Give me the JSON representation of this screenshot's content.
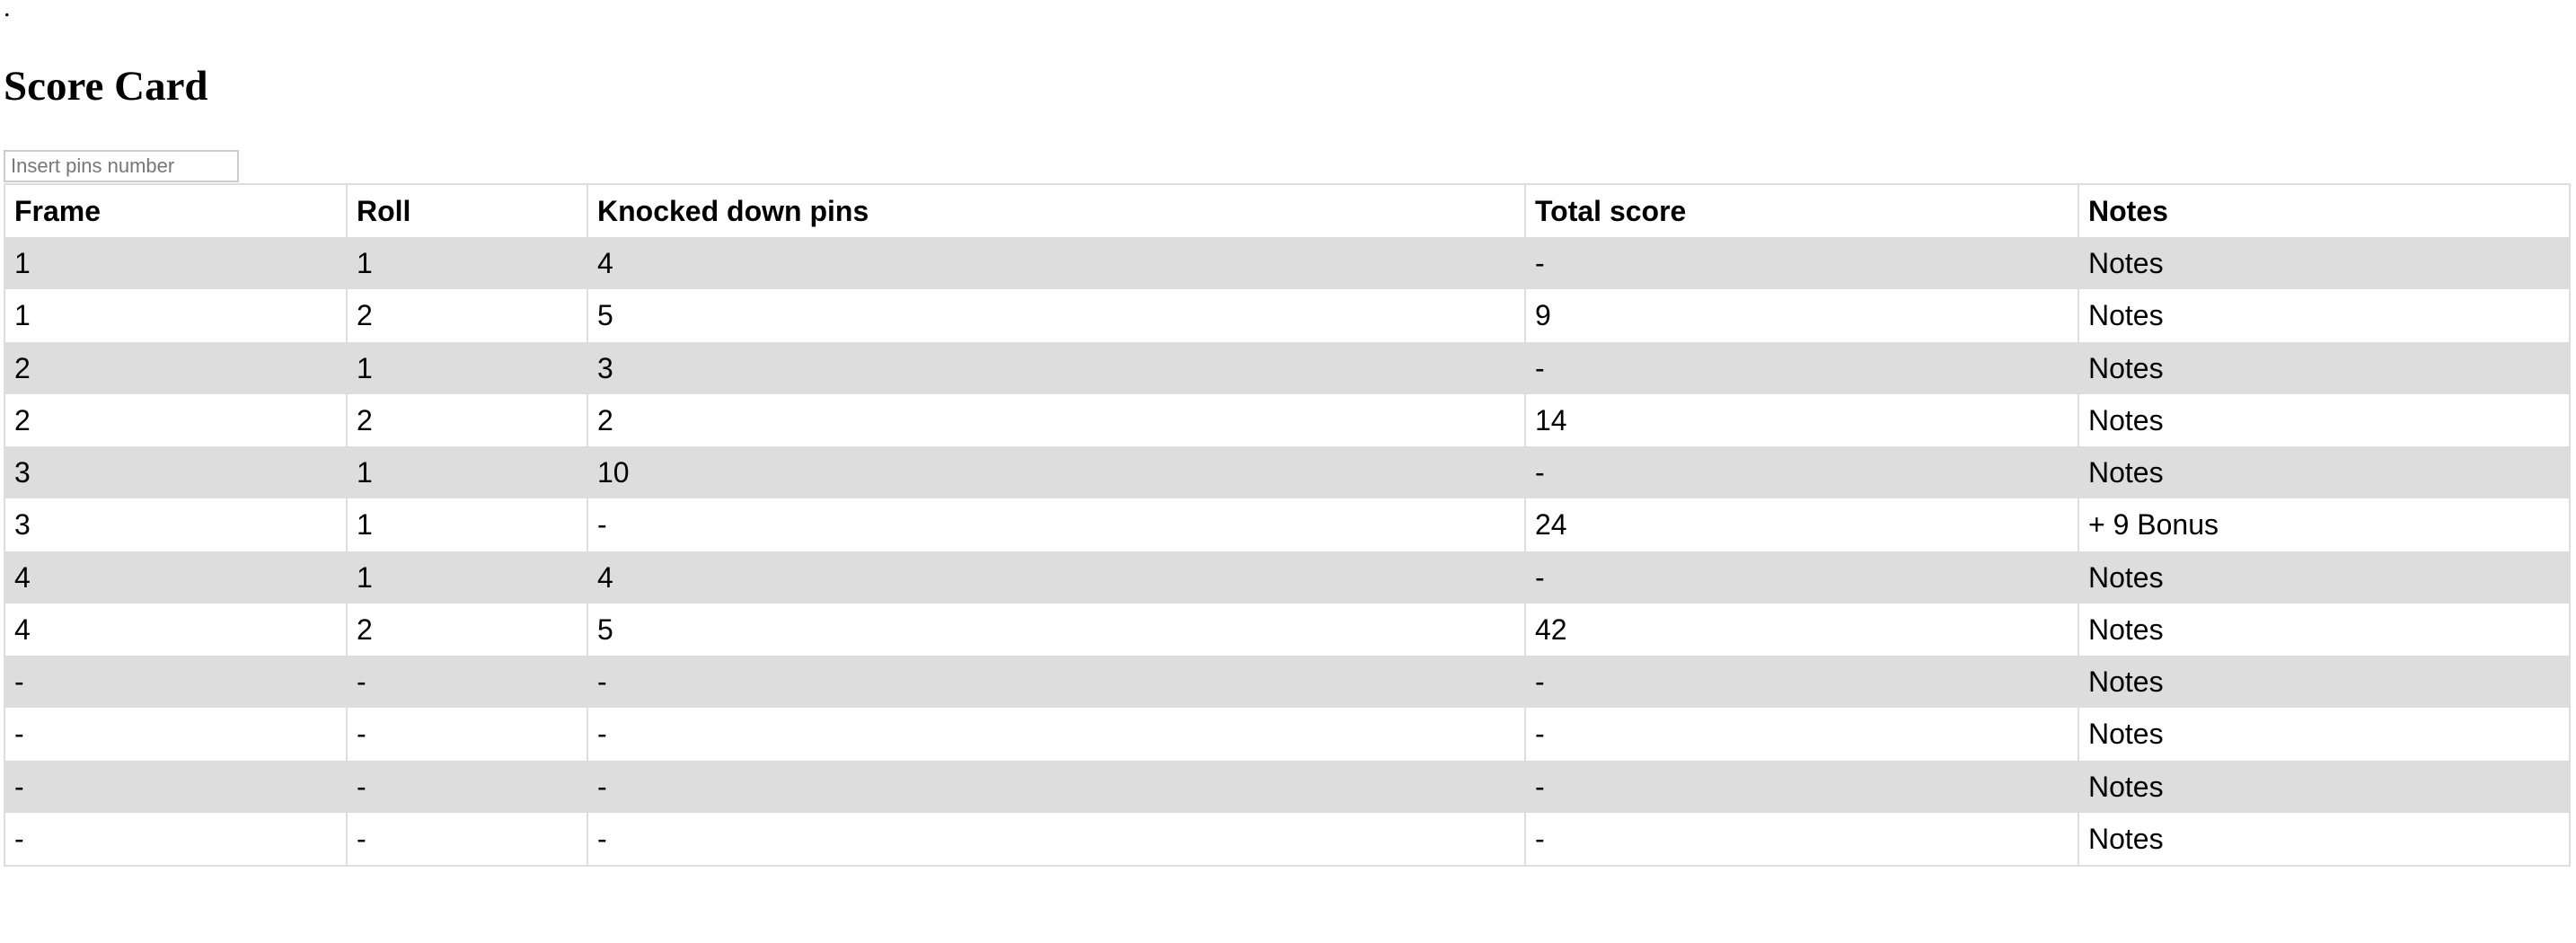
{
  "page": {
    "dot": ".",
    "title": "Score Card"
  },
  "pins_input": {
    "value": "",
    "placeholder": "Insert pins number"
  },
  "table": {
    "headers": {
      "frame": "Frame",
      "roll": "Roll",
      "pins": "Knocked down pins",
      "total": "Total score",
      "notes": "Notes"
    },
    "rows": [
      {
        "frame": "1",
        "roll": "1",
        "pins": "4",
        "total": "-",
        "notes": "Notes"
      },
      {
        "frame": "1",
        "roll": "2",
        "pins": "5",
        "total": "9",
        "notes": "Notes"
      },
      {
        "frame": "2",
        "roll": "1",
        "pins": "3",
        "total": "-",
        "notes": "Notes"
      },
      {
        "frame": "2",
        "roll": "2",
        "pins": "2",
        "total": "14",
        "notes": "Notes"
      },
      {
        "frame": "3",
        "roll": "1",
        "pins": "10",
        "total": "-",
        "notes": "Notes"
      },
      {
        "frame": "3",
        "roll": "1",
        "pins": "-",
        "total": "24",
        "notes": "+ 9 Bonus"
      },
      {
        "frame": "4",
        "roll": "1",
        "pins": "4",
        "total": "-",
        "notes": "Notes"
      },
      {
        "frame": "4",
        "roll": "2",
        "pins": "5",
        "total": "42",
        "notes": "Notes"
      },
      {
        "frame": "-",
        "roll": "-",
        "pins": "-",
        "total": "-",
        "notes": "Notes"
      },
      {
        "frame": "-",
        "roll": "-",
        "pins": "-",
        "total": "-",
        "notes": "Notes"
      },
      {
        "frame": "-",
        "roll": "-",
        "pins": "-",
        "total": "-",
        "notes": "Notes"
      },
      {
        "frame": "-",
        "roll": "-",
        "pins": "-",
        "total": "-",
        "notes": "Notes"
      }
    ]
  },
  "colors": {
    "stripe": "#dddddd",
    "border": "#dddddd",
    "input_border": "#cccccc"
  }
}
